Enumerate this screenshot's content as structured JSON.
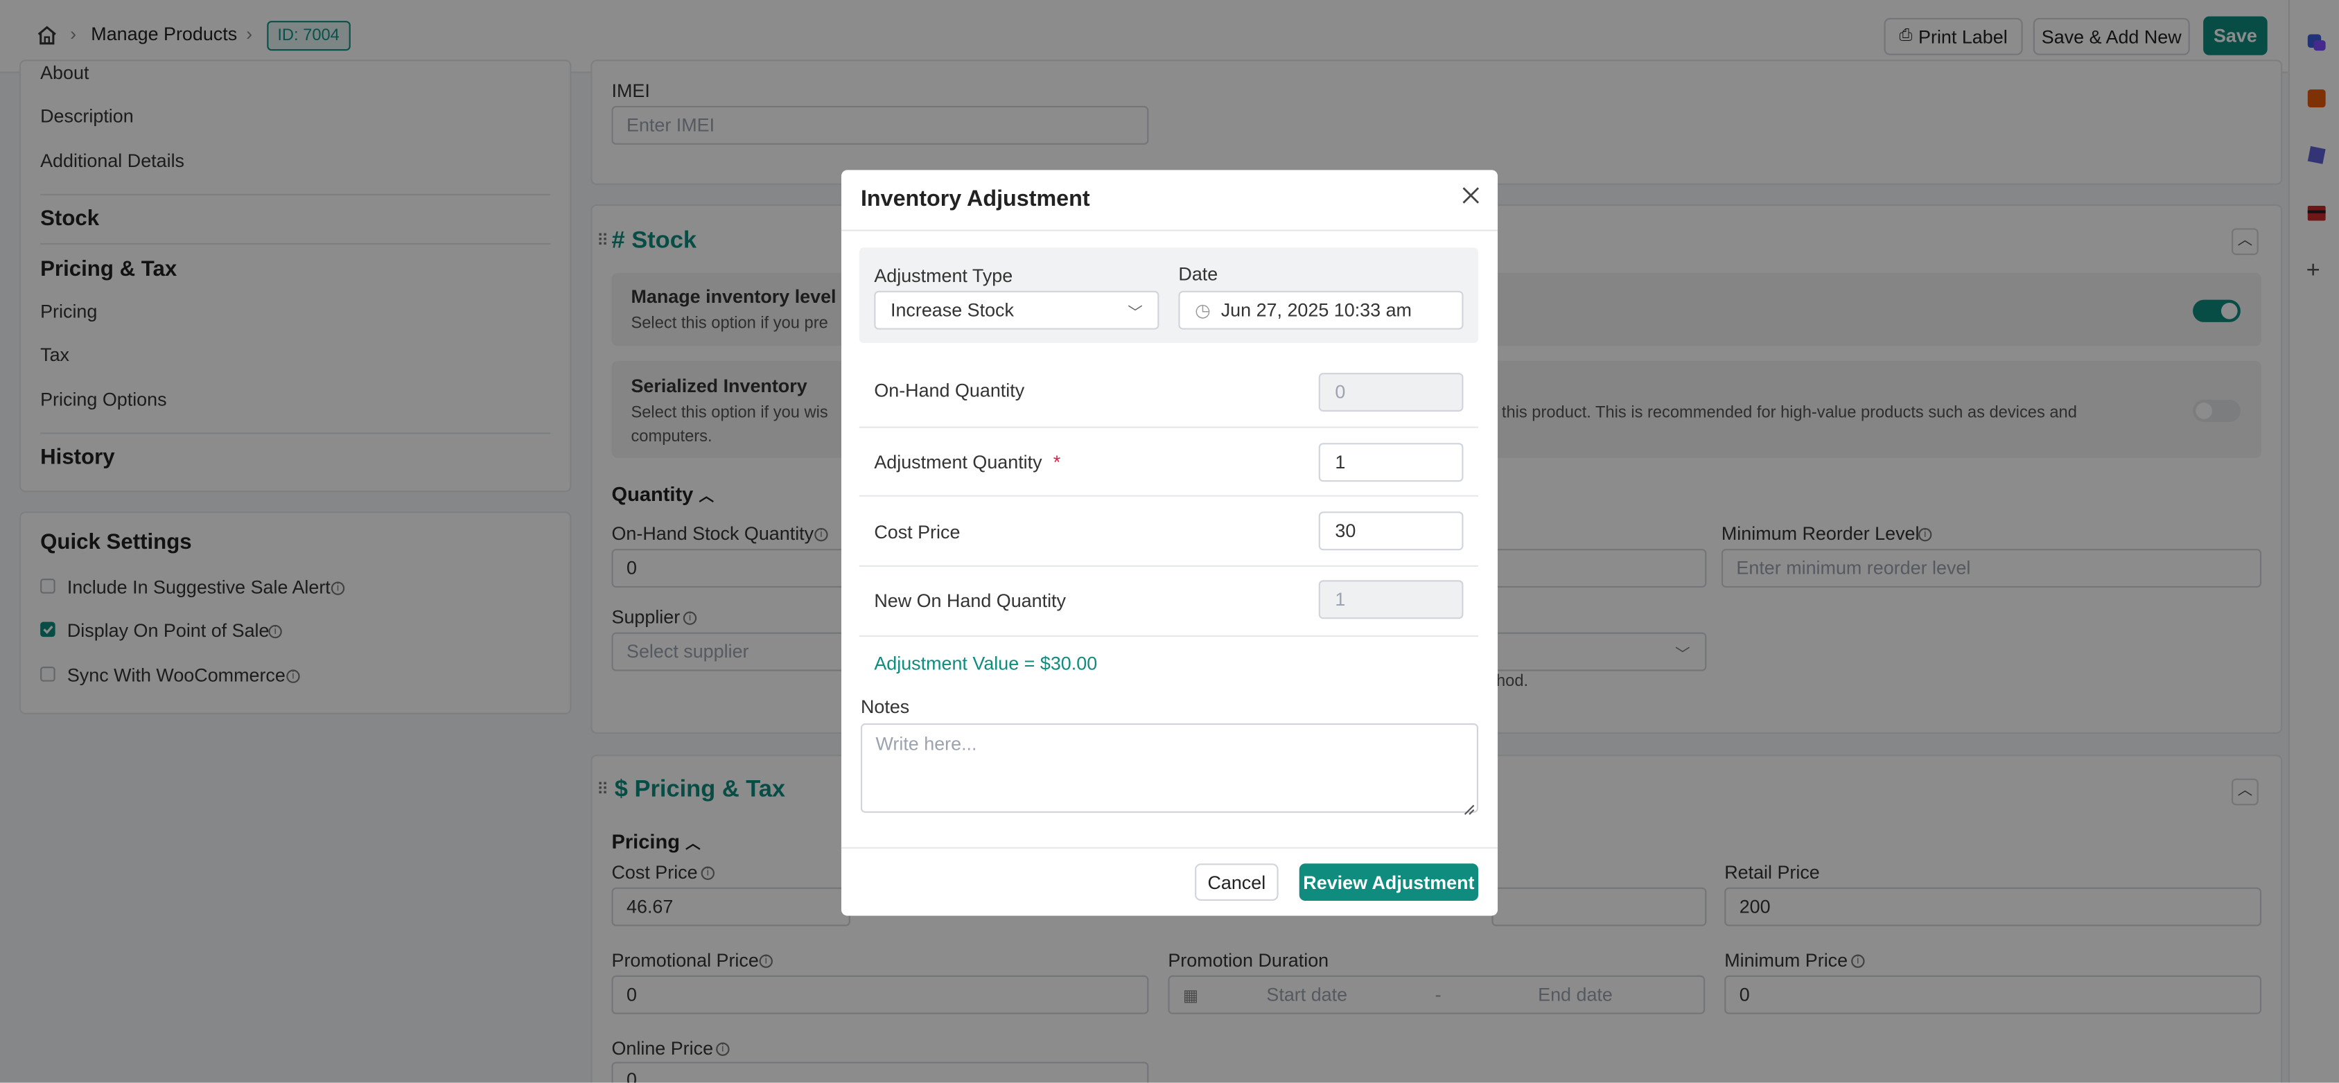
{
  "header": {
    "breadcrumb": "Manage Products",
    "id_badge": "ID: 7004",
    "print_label": "Print Label",
    "save_add_new": "Save & Add New",
    "save": "Save"
  },
  "sidebar": {
    "items_top": [
      "About",
      "Description",
      "Additional Details"
    ],
    "stock_heading": "Stock",
    "pricing_heading": "Pricing & Tax",
    "pricing_items": [
      "Pricing",
      "Tax",
      "Pricing Options"
    ],
    "history_heading": "History"
  },
  "quick_settings": {
    "title": "Quick Settings",
    "items": [
      {
        "label": "Include In Suggestive Sale Alert",
        "checked": false
      },
      {
        "label": "Display On Point of Sale",
        "checked": true
      },
      {
        "label": "Sync With WooCommerce",
        "checked": false
      }
    ]
  },
  "imei": {
    "label": "IMEI",
    "placeholder": "Enter IMEI"
  },
  "stock_section": {
    "title": "# Stock",
    "manage_title": "Manage inventory level fo",
    "manage_desc": "Select this option if you pre",
    "manage_toggle": true,
    "serialized_title": "Serialized Inventory",
    "serialized_desc_left": "Select this option if you wis",
    "serialized_desc_right": "r this product. This is recommended for high-value products such as devices and",
    "serialized_desc_line2": "computers.",
    "serialized_toggle": false,
    "quantity_heading": "Quantity",
    "on_hand_label": "On-Hand Stock Quantity",
    "on_hand_value": "0",
    "min_reorder_label": "Minimum Reorder Level",
    "min_reorder_placeholder": "Enter minimum reorder level",
    "supplier_label": "Supplier",
    "supplier_placeholder": "Select supplier",
    "method_hint": "thod."
  },
  "pricing_section": {
    "title": "$ Pricing & Tax",
    "pricing_heading": "Pricing",
    "cost_price_label": "Cost Price",
    "cost_price_value": "46.67",
    "retail_price_label": "Retail Price",
    "retail_price_value": "200",
    "promo_price_label": "Promotional Price",
    "promo_price_value": "0",
    "promo_duration_label": "Promotion Duration",
    "start_date": "Start date",
    "date_sep": "-",
    "end_date": "End date",
    "min_price_label": "Minimum Price",
    "min_price_value": "0",
    "online_price_label": "Online Price",
    "online_price_value": "0"
  },
  "modal": {
    "title": "Inventory Adjustment",
    "adjustment_type_label": "Adjustment Type",
    "adjustment_type_value": "Increase Stock",
    "date_label": "Date",
    "date_value": "Jun 27, 2025 10:33 am",
    "on_hand_label": "On-Hand Quantity",
    "on_hand_value": "0",
    "adj_qty_label": "Adjustment Quantity",
    "required_mark": "*",
    "adj_qty_value": "1",
    "cost_price_label": "Cost Price",
    "cost_price_value": "30",
    "new_on_hand_label": "New On Hand Quantity",
    "new_on_hand_value": "1",
    "adjustment_value_text": "Adjustment Value = $30.00",
    "notes_label": "Notes",
    "notes_placeholder": "Write here...",
    "cancel": "Cancel",
    "review": "Review Adjustment"
  },
  "colors": {
    "accent": "#0f8c7e",
    "required": "#e11d48"
  },
  "right_rail_icons": [
    "chat-icon",
    "note-icon",
    "cube-icon",
    "card-icon",
    "plus-icon"
  ]
}
